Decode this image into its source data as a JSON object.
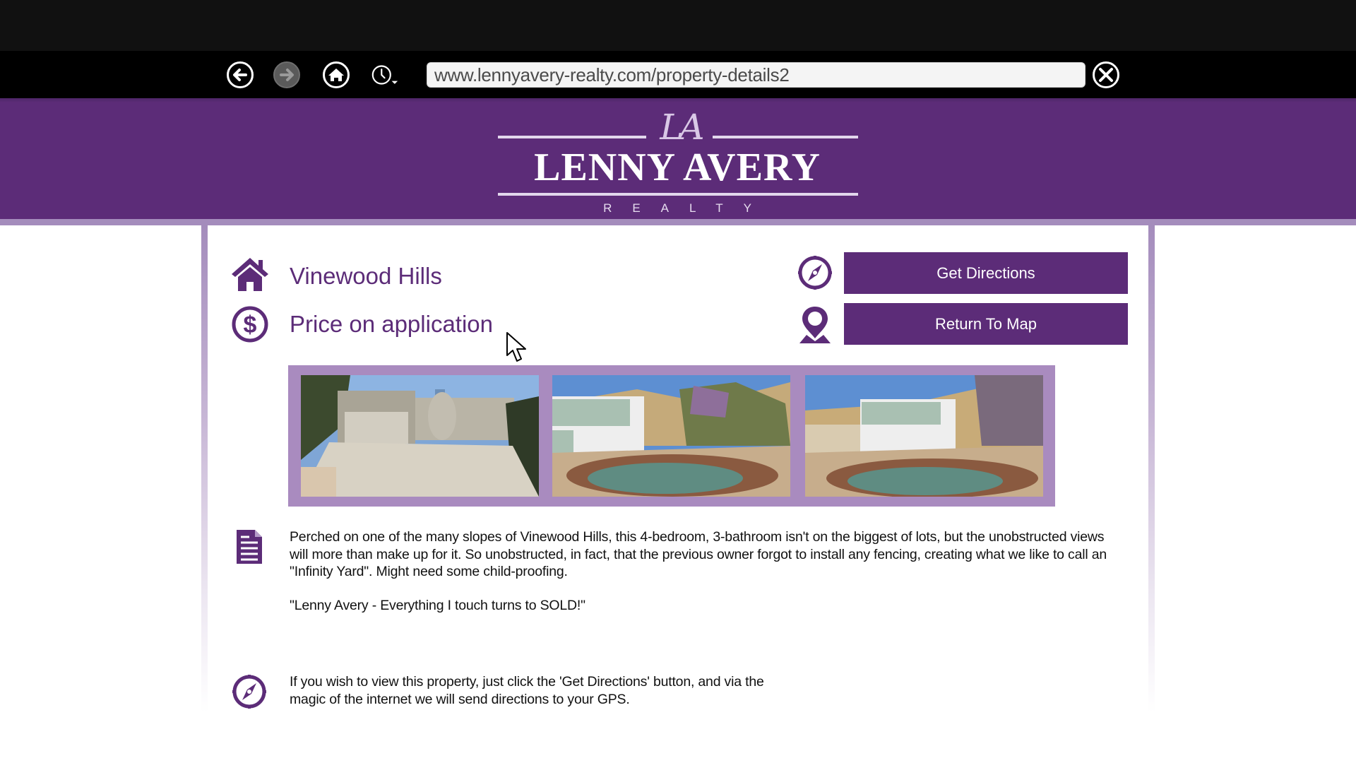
{
  "browser": {
    "url": "www.lennyavery-realty.com/property-details2",
    "buttons": {
      "back": "back-icon",
      "forward": "forward-icon",
      "home": "home-icon",
      "history": "history-icon",
      "close": "close-icon"
    }
  },
  "header": {
    "monogram": "LA",
    "brand": "LENNY AVERY",
    "subtitle": "REALTY"
  },
  "property": {
    "location": "Vinewood Hills",
    "price": "Price on application"
  },
  "actions": {
    "get_directions": "Get Directions",
    "return_to_map": "Return To Map"
  },
  "gallery": {
    "images": [
      {
        "subject": "front of house with garage and driveway"
      },
      {
        "subject": "rear of house with swimming pool"
      },
      {
        "subject": "rear of house with swimming pool, angled view"
      }
    ]
  },
  "description": {
    "body": "Perched on one of the many slopes of Vinewood Hills, this 4-bedroom, 3-bathroom isn't on the biggest of lots, but the unobstructed views will more than make up for it. So unobstructed, in fact, that the previous owner forgot to install any fencing, creating what we like to call an \"Infinity Yard\". Might need some child-proofing.",
    "quote": "\"Lenny Avery - Everything I touch turns to SOLD!\""
  },
  "info": {
    "text": "If you wish to view this property, just click the 'Get Directions' button, and via the magic of the internet we will send directions to your GPS."
  },
  "colors": {
    "brand_purple": "#5c2c78",
    "frame_lilac": "#a98bbf",
    "stripe_lilac": "#a48cbc"
  }
}
